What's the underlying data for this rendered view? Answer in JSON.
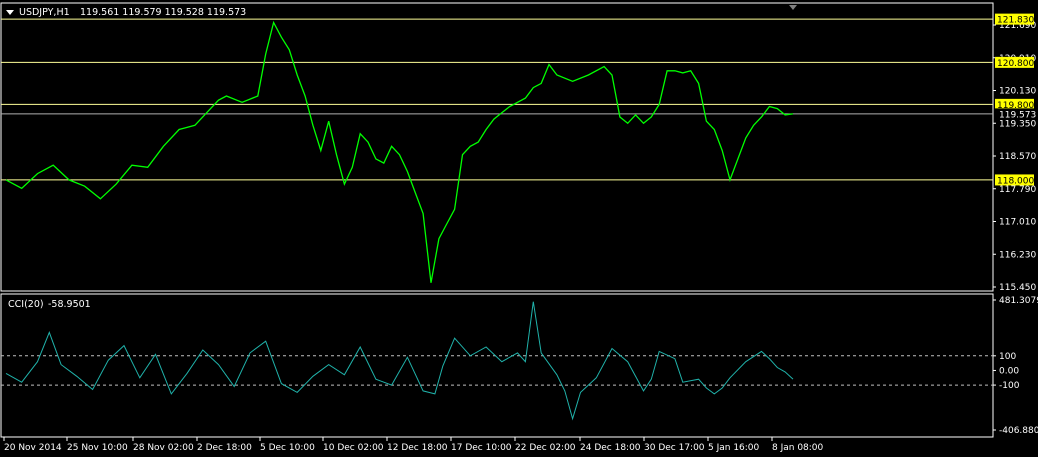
{
  "colors": {
    "background": "#000000",
    "frame": "#ffffff",
    "price_line": "#00ff00",
    "cci_line": "#20b2aa",
    "level_line": "#ffff99",
    "level_tag_bg": "#ffff00",
    "text": "#ffffff"
  },
  "icons": {
    "menu": "triangle-down-icon"
  },
  "header": {
    "symbol_timeframe": "USDJPY,H1",
    "ohlc": "119.561 119.579 119.528 119.573"
  },
  "cci_header": {
    "name": "CCI(20)",
    "value": "-58.9501"
  },
  "chart_data": [
    {
      "type": "line",
      "title": "USDJPY,H1",
      "y_ticks": [
        "121.690",
        "120.910",
        "120.130",
        "119.350",
        "118.570",
        "117.790",
        "117.010",
        "116.230",
        "115.450"
      ],
      "ylim": [
        115.45,
        121.69
      ],
      "levels": [
        "121.830",
        "120.800",
        "119.800",
        "118.000"
      ],
      "current_price": "119.573",
      "x_labels": [
        "20 Nov 2014",
        "25 Nov 10:00",
        "28 Nov 02:00",
        "2 Dec 18:00",
        "5 Dec 10:00",
        "10 Dec 02:00",
        "12 Dec 18:00",
        "17 Dec 10:00",
        "22 Dec 02:00",
        "24 Dec 18:00",
        "30 Dec 17:00",
        "5 Jan 16:00",
        "8 Jan 08:00"
      ],
      "series": [
        {
          "points": [
            [
              0,
              118.0
            ],
            [
              0.02,
              117.8
            ],
            [
              0.04,
              118.15
            ],
            [
              0.06,
              118.35
            ],
            [
              0.08,
              118.0
            ],
            [
              0.1,
              117.85
            ],
            [
              0.12,
              117.55
            ],
            [
              0.14,
              117.9
            ],
            [
              0.16,
              118.35
            ],
            [
              0.18,
              118.3
            ],
            [
              0.2,
              118.8
            ],
            [
              0.22,
              119.2
            ],
            [
              0.24,
              119.3
            ],
            [
              0.26,
              119.7
            ],
            [
              0.27,
              119.9
            ],
            [
              0.28,
              120.0
            ],
            [
              0.3,
              119.85
            ],
            [
              0.32,
              120.0
            ],
            [
              0.33,
              121.0
            ],
            [
              0.34,
              121.75
            ],
            [
              0.35,
              121.4
            ],
            [
              0.36,
              121.1
            ],
            [
              0.37,
              120.5
            ],
            [
              0.38,
              120.0
            ],
            [
              0.39,
              119.3
            ],
            [
              0.4,
              118.7
            ],
            [
              0.41,
              119.4
            ],
            [
              0.42,
              118.6
            ],
            [
              0.43,
              117.9
            ],
            [
              0.44,
              118.3
            ],
            [
              0.45,
              119.1
            ],
            [
              0.46,
              118.9
            ],
            [
              0.47,
              118.5
            ],
            [
              0.48,
              118.4
            ],
            [
              0.49,
              118.8
            ],
            [
              0.5,
              118.6
            ],
            [
              0.51,
              118.2
            ],
            [
              0.52,
              117.7
            ],
            [
              0.53,
              117.2
            ],
            [
              0.54,
              115.55
            ],
            [
              0.55,
              116.6
            ],
            [
              0.56,
              116.95
            ],
            [
              0.57,
              117.3
            ],
            [
              0.58,
              118.6
            ],
            [
              0.59,
              118.8
            ],
            [
              0.6,
              118.9
            ],
            [
              0.61,
              119.2
            ],
            [
              0.62,
              119.45
            ],
            [
              0.63,
              119.6
            ],
            [
              0.64,
              119.75
            ],
            [
              0.66,
              119.95
            ],
            [
              0.67,
              120.2
            ],
            [
              0.68,
              120.3
            ],
            [
              0.69,
              120.75
            ],
            [
              0.7,
              120.5
            ],
            [
              0.72,
              120.35
            ],
            [
              0.74,
              120.5
            ],
            [
              0.76,
              120.7
            ],
            [
              0.77,
              120.5
            ],
            [
              0.78,
              119.5
            ],
            [
              0.79,
              119.35
            ],
            [
              0.8,
              119.55
            ],
            [
              0.81,
              119.35
            ],
            [
              0.82,
              119.5
            ],
            [
              0.83,
              119.8
            ],
            [
              0.84,
              120.6
            ],
            [
              0.85,
              120.6
            ],
            [
              0.86,
              120.55
            ],
            [
              0.87,
              120.6
            ],
            [
              0.88,
              120.3
            ],
            [
              0.89,
              119.4
            ],
            [
              0.9,
              119.2
            ],
            [
              0.91,
              118.7
            ],
            [
              0.92,
              118.0
            ],
            [
              0.93,
              118.5
            ],
            [
              0.94,
              119.0
            ],
            [
              0.95,
              119.3
            ],
            [
              0.96,
              119.5
            ],
            [
              0.97,
              119.75
            ],
            [
              0.98,
              119.7
            ],
            [
              0.99,
              119.55
            ],
            [
              1.0,
              119.573
            ]
          ]
        }
      ]
    },
    {
      "type": "line",
      "title": "CCI(20) -58.9501",
      "y_ticks": [
        "481.3079",
        "100",
        "0.00",
        "-100",
        "-406.8805"
      ],
      "ylim": [
        -406.8805,
        481.3079
      ],
      "levels": [
        100,
        -100
      ],
      "series": [
        {
          "points": [
            [
              0,
              -20
            ],
            [
              0.02,
              -80
            ],
            [
              0.04,
              60
            ],
            [
              0.055,
              260
            ],
            [
              0.07,
              40
            ],
            [
              0.09,
              -40
            ],
            [
              0.11,
              -130
            ],
            [
              0.13,
              70
            ],
            [
              0.15,
              170
            ],
            [
              0.17,
              -50
            ],
            [
              0.19,
              110
            ],
            [
              0.21,
              -160
            ],
            [
              0.23,
              -20
            ],
            [
              0.25,
              140
            ],
            [
              0.27,
              40
            ],
            [
              0.29,
              -110
            ],
            [
              0.31,
              120
            ],
            [
              0.33,
              200
            ],
            [
              0.35,
              -90
            ],
            [
              0.37,
              -150
            ],
            [
              0.39,
              -40
            ],
            [
              0.41,
              40
            ],
            [
              0.43,
              -30
            ],
            [
              0.45,
              160
            ],
            [
              0.47,
              -60
            ],
            [
              0.49,
              -100
            ],
            [
              0.51,
              90
            ],
            [
              0.53,
              -140
            ],
            [
              0.545,
              -160
            ],
            [
              0.555,
              30
            ],
            [
              0.57,
              220
            ],
            [
              0.59,
              100
            ],
            [
              0.61,
              160
            ],
            [
              0.63,
              60
            ],
            [
              0.65,
              120
            ],
            [
              0.66,
              60
            ],
            [
              0.67,
              470
            ],
            [
              0.68,
              120
            ],
            [
              0.7,
              -30
            ],
            [
              0.71,
              -140
            ],
            [
              0.72,
              -330
            ],
            [
              0.73,
              -150
            ],
            [
              0.75,
              -50
            ],
            [
              0.77,
              150
            ],
            [
              0.79,
              60
            ],
            [
              0.81,
              -140
            ],
            [
              0.82,
              -60
            ],
            [
              0.83,
              130
            ],
            [
              0.85,
              80
            ],
            [
              0.86,
              -80
            ],
            [
              0.88,
              -60
            ],
            [
              0.89,
              -120
            ],
            [
              0.9,
              -160
            ],
            [
              0.91,
              -120
            ],
            [
              0.92,
              -50
            ],
            [
              0.94,
              60
            ],
            [
              0.96,
              130
            ],
            [
              0.97,
              80
            ],
            [
              0.98,
              20
            ],
            [
              0.99,
              -10
            ],
            [
              1.0,
              -58.95
            ]
          ]
        }
      ]
    }
  ]
}
